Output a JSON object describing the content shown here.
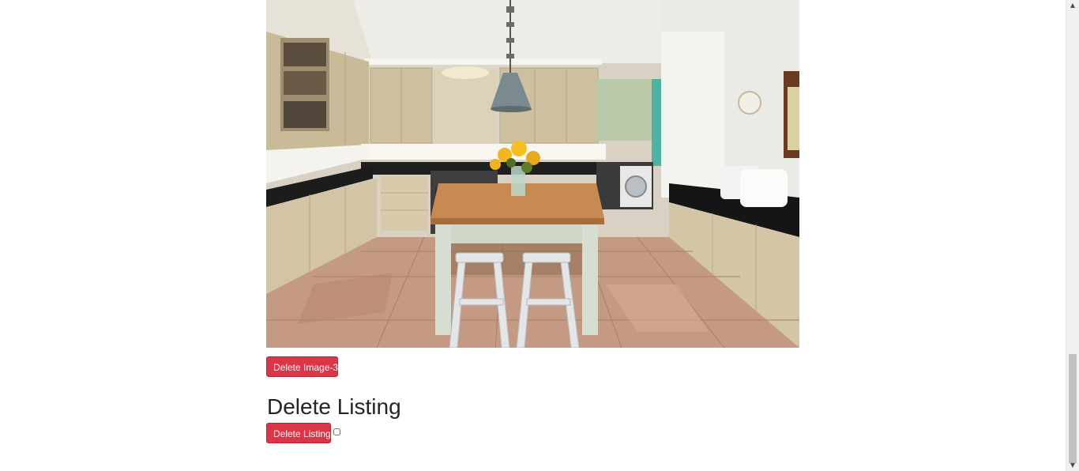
{
  "listing_images": {
    "image_3": {
      "alt": "kitchen-photo"
    },
    "delete_image_3_label": "Delete Image-3"
  },
  "delete_listing": {
    "heading": "Delete Listing",
    "button_label": "Delete Listing",
    "confirm_checked": false
  },
  "colors": {
    "danger": "#dc3545",
    "heading": "#212529",
    "scrollbar_track": "#f1f1f1",
    "scrollbar_thumb": "#c1c1c1"
  },
  "scrollbar": {
    "up_icon": "arrow-up-icon",
    "down_icon": "arrow-down-icon"
  }
}
